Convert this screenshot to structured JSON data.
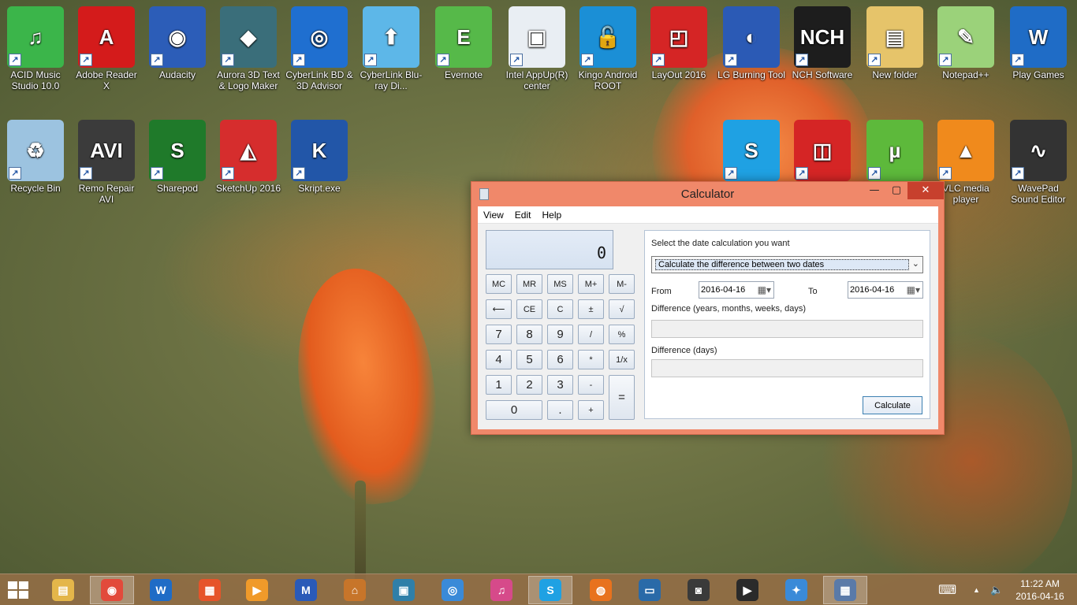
{
  "desktop": {
    "icons": [
      {
        "label": "ACID Music Studio 10.0",
        "icon": "music-note-icon",
        "color": "#3bb54a"
      },
      {
        "label": "Adobe Reader X",
        "icon": "adobe-reader-icon",
        "color": "#d41b1b"
      },
      {
        "label": "Audacity",
        "icon": "audacity-icon",
        "color": "#2c5db8"
      },
      {
        "label": "Aurora 3D Text & Logo Maker",
        "icon": "aurora-3d-icon",
        "color": "#3a6e7a"
      },
      {
        "label": "CyberLink BD & 3D Advisor",
        "icon": "cyberlink-advisor-icon",
        "color": "#1f6fd0"
      },
      {
        "label": "CyberLink Blu-ray Di...",
        "icon": "bluray-disc-icon",
        "color": "#5db7e8"
      },
      {
        "label": "Evernote",
        "icon": "evernote-icon",
        "color": "#56b949"
      },
      {
        "label": "Intel AppUp(R) center",
        "icon": "intel-appup-icon",
        "color": "#e9eef3"
      },
      {
        "label": "Kingo Android ROOT",
        "icon": "kingo-root-icon",
        "color": "#1b8fd6"
      },
      {
        "label": "LayOut 2016",
        "icon": "layout-icon",
        "color": "#d52525"
      },
      {
        "label": "LG Burning Tool",
        "icon": "lg-burning-icon",
        "color": "#2b5ab5"
      },
      {
        "label": "NCH Software",
        "icon": "nch-icon",
        "color": "#1d1d1d"
      },
      {
        "label": "New folder",
        "icon": "folder-icon",
        "color": "#e6c46a"
      },
      {
        "label": "Notepad++",
        "icon": "notepadpp-icon",
        "color": "#9bd27a"
      },
      {
        "label": "Play Games",
        "icon": "play-games-icon",
        "color": "#1f6cc6"
      },
      {
        "label": "Recycle Bin",
        "icon": "recycle-bin-icon",
        "color": "#9cc3e0"
      },
      {
        "label": "Remo Repair AVI",
        "icon": "remo-repair-avi-icon",
        "color": "#3b3b3b"
      },
      {
        "label": "Sharepod",
        "icon": "sharepod-icon",
        "color": "#1f7a2a"
      },
      {
        "label": "SketchUp 2016",
        "icon": "sketchup-icon",
        "color": "#d62d2d"
      },
      {
        "label": "Skript.exe",
        "icon": "skript-icon",
        "color": "#2256a8"
      },
      {
        "label": "",
        "icon": "skype-icon",
        "color": "#1fa1e3"
      },
      {
        "label": "",
        "icon": "sketchup-layout-icon",
        "color": "#d52525"
      },
      {
        "label": "",
        "icon": "utorrent-icon",
        "color": "#5db93b"
      },
      {
        "label": "VLC media player",
        "icon": "vlc-icon",
        "color": "#f08a1c"
      },
      {
        "label": "WavePad Sound Editor",
        "icon": "wavepad-icon",
        "color": "#333333"
      }
    ]
  },
  "window": {
    "title": "Calculator",
    "minimize": "—",
    "maximize": "▢",
    "close": "✕",
    "menu": [
      "View",
      "Edit",
      "Help"
    ]
  },
  "calculator": {
    "display": "0",
    "keys": [
      {
        "label": "MC"
      },
      {
        "label": "MR"
      },
      {
        "label": "MS"
      },
      {
        "label": "M+"
      },
      {
        "label": "M-"
      },
      {
        "label": "⟵"
      },
      {
        "label": "CE"
      },
      {
        "label": "C"
      },
      {
        "label": "±"
      },
      {
        "label": "√"
      },
      {
        "label": "7"
      },
      {
        "label": "8"
      },
      {
        "label": "9"
      },
      {
        "label": "/"
      },
      {
        "label": "%"
      },
      {
        "label": "4"
      },
      {
        "label": "5"
      },
      {
        "label": "6"
      },
      {
        "label": "*"
      },
      {
        "label": "1/x"
      },
      {
        "label": "1"
      },
      {
        "label": "2"
      },
      {
        "label": "3"
      },
      {
        "label": "-"
      },
      {
        "label": "="
      },
      {
        "label": "0"
      },
      {
        "label": "."
      },
      {
        "label": "+"
      }
    ]
  },
  "date_panel": {
    "heading": "Select the date calculation you want",
    "mode": "Calculate the difference between two dates",
    "from_label": "From",
    "from_value": "2016-04-16",
    "to_label": "To",
    "to_value": "2016-04-16",
    "diff_ymwd_label": "Difference (years, months, weeks, days)",
    "diff_ymwd_value": "",
    "diff_days_label": "Difference (days)",
    "diff_days_value": "",
    "calculate_label": "Calculate"
  },
  "taskbar": {
    "items": [
      {
        "icon": "file-explorer-icon",
        "color": "#e4b64a",
        "active": false
      },
      {
        "icon": "chrome-icon",
        "color": "#e24a3b",
        "active": true
      },
      {
        "icon": "play-games-icon",
        "color": "#1f6cc6",
        "active": false
      },
      {
        "icon": "store-icon",
        "color": "#e6542a",
        "active": false
      },
      {
        "icon": "media-player-icon",
        "color": "#f09a2a",
        "active": false
      },
      {
        "icon": "malwarebytes-icon",
        "color": "#2a5ab8",
        "active": false
      },
      {
        "icon": "library-icon",
        "color": "#c7752a",
        "active": false
      },
      {
        "icon": "video-editor-icon",
        "color": "#2f7fa8",
        "active": false
      },
      {
        "icon": "qq-icon",
        "color": "#3a8ad8",
        "active": false
      },
      {
        "icon": "itunes-icon",
        "color": "#d64a8a",
        "active": false
      },
      {
        "icon": "skype-icon",
        "color": "#1fa1e3",
        "active": true
      },
      {
        "icon": "firefox-icon",
        "color": "#e8721e",
        "active": false
      },
      {
        "icon": "remote-desktop-icon",
        "color": "#2a6aa8",
        "active": false
      },
      {
        "icon": "webcam-icon",
        "color": "#3a3a3a",
        "active": false
      },
      {
        "icon": "video-player-icon",
        "color": "#2a2a2a",
        "active": false
      },
      {
        "icon": "safari-icon",
        "color": "#3a8ad8",
        "active": false
      },
      {
        "icon": "calculator-icon",
        "color": "#5a7aa8",
        "active": true
      }
    ],
    "tray": {
      "keyboard_icon": "⌨",
      "chevron_icon": "▲",
      "volume_icon": "🔈"
    },
    "time": "11:22 AM",
    "date": "2016-04-16"
  }
}
